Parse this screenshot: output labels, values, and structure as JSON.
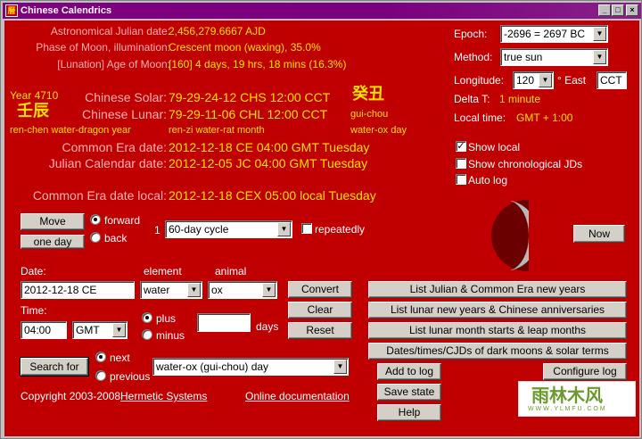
{
  "window": {
    "title": "Chinese Calendrics",
    "icon": "calendar-app-icon",
    "min": "_",
    "max": "□",
    "close": "×"
  },
  "info": {
    "ajd_label": "Astronomical Julian date:",
    "ajd_value": "2,456,279.6667 AJD",
    "phase_label": "Phase of Moon, illumination:",
    "phase_value": "Crescent moon (waxing), 35.0%",
    "age_label": "[Lunation] Age of Moon:",
    "age_value": "[160] 4 days, 19 hrs, 18 mins (16.3%)"
  },
  "year": {
    "label": "Year 4710",
    "stem_branch": "壬辰",
    "name": "ren-chen water-dragon year"
  },
  "day": {
    "stem_branch": "癸丑",
    "pinyin": "gui-chou",
    "name": "water-ox day"
  },
  "chinese": {
    "solar_label": "Chinese Solar:",
    "solar_value": "79-29-24-12 CHS 12:00 CCT",
    "lunar_label": "Chinese Lunar:",
    "lunar_value": "79-29-11-06 CHL 12:00 CCT",
    "month_name": "ren-zi water-rat month"
  },
  "dates": {
    "ce_label": "Common Era date:",
    "ce_value": "2012-12-18 CE 04:00 GMT Tuesday",
    "jc_label": "Julian Calendar date:",
    "jc_value": "2012-12-05 JC 04:00 GMT Tuesday",
    "local_label": "Common Era date local:",
    "local_value": "2012-12-18 CEX 05:00 local Tuesday"
  },
  "settings": {
    "epoch_label": "Epoch:",
    "epoch_value": "-2696 = 2697 BC",
    "method_label": "Method:",
    "method_value": "true sun",
    "longitude_label": "Longitude:",
    "longitude_value": "120",
    "longitude_unit": "° East",
    "tz_value": "CCT",
    "deltat_label": "Delta T:",
    "deltat_value": "1 minute",
    "localtime_label": "Local time:",
    "localtime_value": "GMT + 1:00",
    "show_local": "Show local",
    "show_local_checked": true,
    "show_chrono": "Show chronological JDs",
    "show_chrono_checked": false,
    "auto_log": "Auto log",
    "auto_log_checked": false
  },
  "move": {
    "move_label": "Move",
    "unit_label": "one day",
    "forward": "forward",
    "back": "back",
    "count": "1",
    "cycle_value": "60-day cycle",
    "repeatedly": "repeatedly",
    "now_label": "Now"
  },
  "input": {
    "date_label": "Date:",
    "date_value": "2012-12-18 CE",
    "element_label": "element",
    "element_value": "water",
    "animal_label": "animal",
    "animal_value": "ox",
    "time_label": "Time:",
    "time_value": "04:00",
    "tz_select": "GMT",
    "plus": "plus",
    "minus": "minus",
    "days_value": "",
    "days_label": "days",
    "convert": "Convert",
    "clear": "Clear",
    "reset": "Reset"
  },
  "search": {
    "button": "Search for",
    "next": "next",
    "previous": "previous",
    "target_value": "water-ox (gui-chou) day"
  },
  "lists": {
    "julian_ce": "List Julian & Common Era new years",
    "lunar_ny": "List lunar new years & Chinese anniversaries",
    "lunar_months": "List lunar month starts & leap months",
    "dark_moons": "Dates/times/CJDs of dark moons & solar terms",
    "add_log": "Add to log",
    "configure_log": "Configure log",
    "save_state": "Save state",
    "help": "Help"
  },
  "footer": {
    "copyright": "Copyright 2003-2008",
    "company": "Hermetic Systems",
    "docs": "Online documentation"
  },
  "watermark": {
    "brand": "雨林木风",
    "url": "W W W . Y L M F U . C O M"
  },
  "colors": {
    "background": "#c00000",
    "value": "#ffe000",
    "label": "#ffb0b0",
    "title": "#800080"
  }
}
